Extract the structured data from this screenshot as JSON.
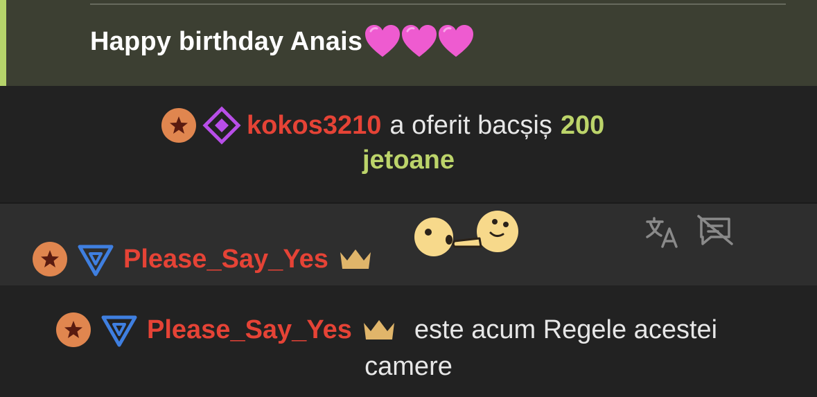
{
  "highlight_message": {
    "text": "Happy birthday Anais",
    "emoji": [
      "pink-heart",
      "pink-heart",
      "pink-heart"
    ],
    "accent_color": "#b5d36a"
  },
  "tip_notice": {
    "username": "kokos3210",
    "action": "a oferit bacșiș",
    "amount": "200",
    "unit": "jetoane",
    "badges": [
      "star-badge",
      "diamond-badge"
    ]
  },
  "emote_message": {
    "username": "Please_Say_Yes",
    "badges": [
      "star-badge",
      "triangle-badge",
      "crown-icon"
    ],
    "emote": "poke-emote",
    "actions": [
      "translate-icon",
      "hide-message-icon"
    ]
  },
  "king_notice": {
    "username": "Please_Say_Yes",
    "text_line1": "este acum Regele acestei",
    "text_line2": "camere",
    "badges": [
      "star-badge",
      "triangle-badge",
      "crown-icon"
    ]
  },
  "colors": {
    "username": "#e54336",
    "amount": "#bcd46a",
    "star_badge": "#e0864f",
    "diamond_badge": "#b84ee8",
    "triangle_badge": "#3f7fe0",
    "crown": "#e0b56a",
    "heart": "#ee5bd0"
  }
}
